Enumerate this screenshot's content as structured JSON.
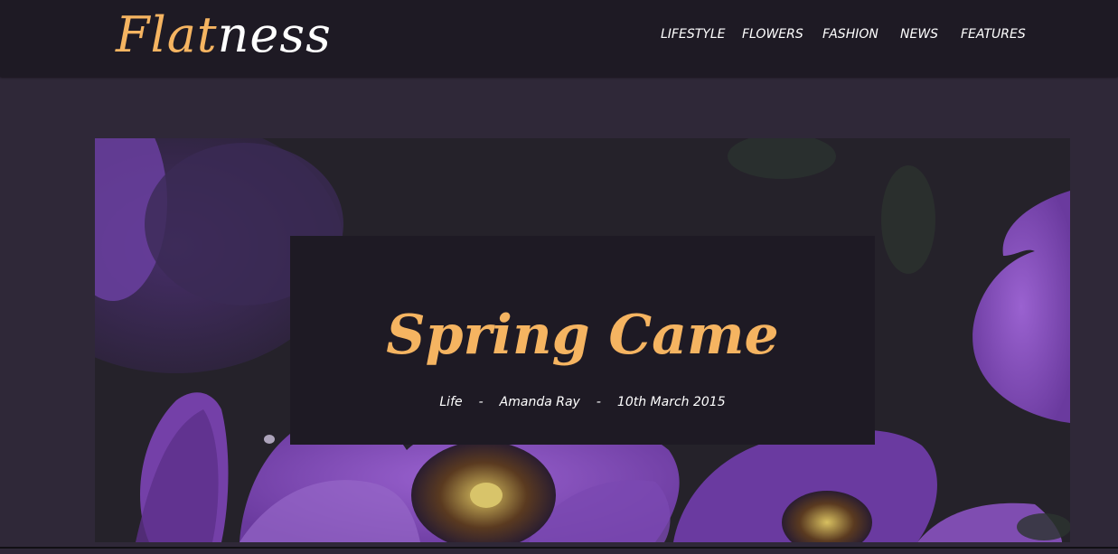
{
  "header": {
    "logo_part1": "Flat",
    "logo_part2": "ness",
    "nav": [
      {
        "label": "LIFESTYLE"
      },
      {
        "label": "FLOWERS"
      },
      {
        "label": "FASHION"
      },
      {
        "label": "NEWS"
      },
      {
        "label": "FEATURES"
      }
    ]
  },
  "hero": {
    "title": "Spring Came",
    "category": "Life",
    "separator": "-",
    "author": "Amanda Ray",
    "date": "10th March 2015"
  },
  "colors": {
    "accent": "#f5b461",
    "header_bg": "#1e1a24",
    "page_bg": "#2f2838",
    "petal": "#8a52c0"
  },
  "icons": {
    "hero_image": "purple-petunia-flowers-image"
  }
}
